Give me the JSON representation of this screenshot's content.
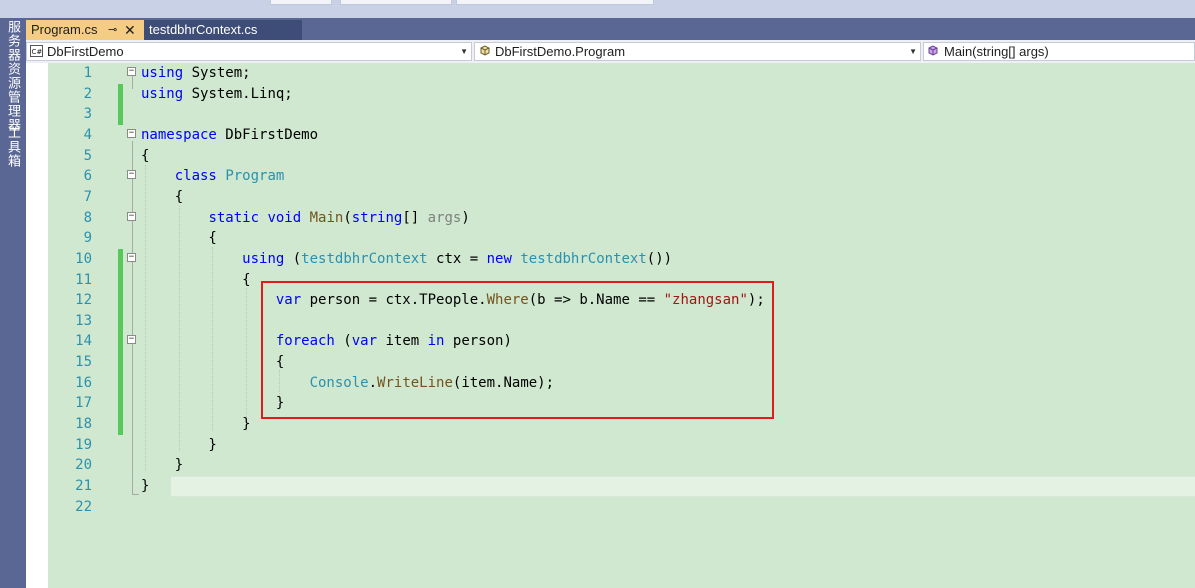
{
  "sidebar": {
    "vertical_tabs": [
      "服务器资源管理器",
      "工具箱"
    ]
  },
  "tabs": [
    {
      "label": "Program.cs",
      "active": true,
      "pin_icon": "pin-icon",
      "close_icon": "close-icon"
    },
    {
      "label": "testdbhrContext.cs",
      "active": false
    }
  ],
  "navbar": {
    "project": "DbFirstDemo",
    "type": "DbFirstDemo.Program",
    "member": "Main(string[] args)"
  },
  "colors": {
    "keyword": "#0000ff",
    "type": "#2b91af",
    "method": "#74531f",
    "string": "#a31515",
    "editor_background": "#cfe8cf",
    "change_marker": "#57c85a",
    "highlight_box": "#e11a1a",
    "active_tab": "#f5cc84"
  },
  "editor": {
    "line_numbers": [
      "1",
      "2",
      "3",
      "4",
      "5",
      "6",
      "7",
      "8",
      "9",
      "10",
      "11",
      "12",
      "13",
      "14",
      "15",
      "16",
      "17",
      "18",
      "19",
      "20",
      "21",
      "22"
    ],
    "lines": [
      {
        "tokens": [
          {
            "c": "k",
            "t": "using"
          },
          {
            "c": "",
            "t": " System;"
          }
        ]
      },
      {
        "tokens": [
          {
            "c": "k",
            "t": "using"
          },
          {
            "c": "",
            "t": " System.Linq;"
          }
        ]
      },
      {
        "tokens": []
      },
      {
        "tokens": [
          {
            "c": "k",
            "t": "namespace"
          },
          {
            "c": "",
            "t": " DbFirstDemo"
          }
        ]
      },
      {
        "tokens": [
          {
            "c": "",
            "t": "{"
          }
        ]
      },
      {
        "tokens": [
          {
            "c": "",
            "t": "    "
          },
          {
            "c": "k",
            "t": "class"
          },
          {
            "c": "",
            "t": " "
          },
          {
            "c": "t",
            "t": "Program"
          }
        ]
      },
      {
        "tokens": [
          {
            "c": "",
            "t": "    {"
          }
        ]
      },
      {
        "tokens": [
          {
            "c": "",
            "t": "        "
          },
          {
            "c": "k",
            "t": "static"
          },
          {
            "c": "",
            "t": " "
          },
          {
            "c": "k",
            "t": "void"
          },
          {
            "c": "",
            "t": " "
          },
          {
            "c": "m",
            "t": "Main"
          },
          {
            "c": "",
            "t": "("
          },
          {
            "c": "k",
            "t": "string"
          },
          {
            "c": "",
            "t": "[] "
          },
          {
            "c": "p",
            "t": "args"
          },
          {
            "c": "",
            "t": ")"
          }
        ]
      },
      {
        "tokens": [
          {
            "c": "",
            "t": "        {"
          }
        ]
      },
      {
        "tokens": [
          {
            "c": "",
            "t": "            "
          },
          {
            "c": "k",
            "t": "using"
          },
          {
            "c": "",
            "t": " ("
          },
          {
            "c": "t",
            "t": "testdbhrContext"
          },
          {
            "c": "",
            "t": " ctx = "
          },
          {
            "c": "k",
            "t": "new"
          },
          {
            "c": "",
            "t": " "
          },
          {
            "c": "t",
            "t": "testdbhrContext"
          },
          {
            "c": "",
            "t": "())"
          }
        ]
      },
      {
        "tokens": [
          {
            "c": "",
            "t": "            {"
          }
        ]
      },
      {
        "tokens": [
          {
            "c": "",
            "t": "                "
          },
          {
            "c": "k",
            "t": "var"
          },
          {
            "c": "",
            "t": " person = ctx.TPeople."
          },
          {
            "c": "m",
            "t": "Where"
          },
          {
            "c": "",
            "t": "(b => b.Name == "
          },
          {
            "c": "s",
            "t": "\"zhangsan\""
          },
          {
            "c": "",
            "t": ");"
          }
        ]
      },
      {
        "tokens": []
      },
      {
        "tokens": [
          {
            "c": "",
            "t": "                "
          },
          {
            "c": "k",
            "t": "foreach"
          },
          {
            "c": "",
            "t": " ("
          },
          {
            "c": "k",
            "t": "var"
          },
          {
            "c": "",
            "t": " item "
          },
          {
            "c": "k",
            "t": "in"
          },
          {
            "c": "",
            "t": " person)"
          }
        ]
      },
      {
        "tokens": [
          {
            "c": "",
            "t": "                {"
          }
        ]
      },
      {
        "tokens": [
          {
            "c": "",
            "t": "                    "
          },
          {
            "c": "t",
            "t": "Console"
          },
          {
            "c": "",
            "t": "."
          },
          {
            "c": "m",
            "t": "WriteLine"
          },
          {
            "c": "",
            "t": "(item.Name);"
          }
        ]
      },
      {
        "tokens": [
          {
            "c": "",
            "t": "                }"
          }
        ]
      },
      {
        "tokens": [
          {
            "c": "",
            "t": "            }"
          }
        ]
      },
      {
        "tokens": [
          {
            "c": "",
            "t": "        }"
          }
        ]
      },
      {
        "tokens": [
          {
            "c": "",
            "t": "    }"
          }
        ]
      },
      {
        "tokens": [
          {
            "c": "",
            "t": "}"
          }
        ]
      },
      {
        "tokens": []
      }
    ],
    "changed_lines": [
      "2",
      "3",
      "10",
      "11",
      "12",
      "13",
      "14",
      "15",
      "16",
      "17",
      "18"
    ],
    "fold_lines": [
      "1",
      "4",
      "6",
      "8",
      "10",
      "14"
    ]
  }
}
